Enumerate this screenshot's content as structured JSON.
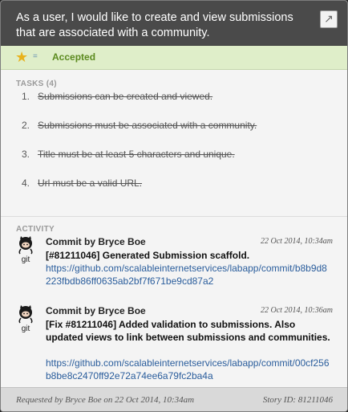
{
  "story": {
    "title": "As a user, I would like to create and view submissions that are associated with a community.",
    "expand_icon": "↗",
    "star_icon": "★",
    "estimate": "=",
    "state": "Accepted",
    "state_color": "#5b8a1e"
  },
  "tasks": {
    "title": "TASKS (4)",
    "items": [
      {
        "num": "1.",
        "text": "Submissions can be created and viewed."
      },
      {
        "num": "2.",
        "text": "Submissions must be associated with a community."
      },
      {
        "num": "3.",
        "text": "Title must be at least 5 characters and unique."
      },
      {
        "num": "4.",
        "text": "Url must be a valid URL."
      }
    ]
  },
  "activity": {
    "title": "ACTIVITY",
    "comments": [
      {
        "author": "Commit by Bryce Boe",
        "date": "22 Oct 2014, 10:34am",
        "message": "[#81211046] Generated Submission scaffold.",
        "link": "https://github.com/scalableinternetservices/labapp/commit/b8b9d8223fbdb86ff0635ab2bf7f671be9cd87a2",
        "avatar_label": "git"
      },
      {
        "author": "Commit by Bryce Boe",
        "date": "22 Oct 2014, 10:36am",
        "message": "[Fix #81211046] Added validation to submissions. Also updated views to link between submissions and communities.",
        "link": "https://github.com/scalableinternetservices/labapp/commit/00cf256b8be8c2470ff92e72a74ee6a79fc2ba4a",
        "avatar_label": "git"
      }
    ]
  },
  "footer": {
    "requested": "Requested by Bryce Boe on 22 Oct 2014, 10:34am",
    "story_id": "Story ID: 81211046"
  }
}
